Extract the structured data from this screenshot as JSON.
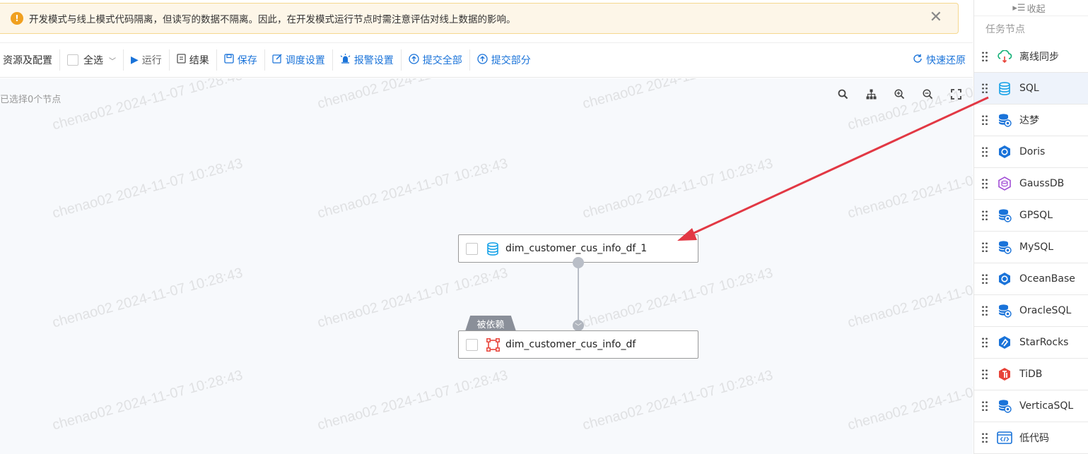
{
  "banner": {
    "message": "开发模式与线上模式代码隔离，但读写的数据不隔离。因此，在开发模式运行节点时需注意评估对线上数据的影响。",
    "close": "✕"
  },
  "toolbar": {
    "resources": "资源及配置",
    "select_all": "全选",
    "run": "运行",
    "results": "结果",
    "save": "保存",
    "schedule": "调度设置",
    "alarm": "报警设置",
    "submit_all": "提交全部",
    "submit_part": "提交部分",
    "quick_restore": "快速还原"
  },
  "canvas": {
    "selected_info": "已选择0个节点",
    "watermark": "chenao02 2024-11-07 10:28:43",
    "nodes": [
      {
        "label": "dim_customer_cus_info_df_1",
        "type": "SQL"
      },
      {
        "label": "dim_customer_cus_info_df",
        "type": "table"
      }
    ],
    "dependency_tag": "被依赖"
  },
  "panel": {
    "collapse": "收起",
    "title": "任务节点",
    "items": [
      {
        "label": "离线同步",
        "icon": "cloud-sync-icon",
        "color": "#19b27a"
      },
      {
        "label": "SQL",
        "icon": "database-icon",
        "color": "#1aa3e8"
      },
      {
        "label": "达梦",
        "icon": "dameng-db-icon",
        "color": "#1a73d9"
      },
      {
        "label": "Doris",
        "icon": "doris-icon",
        "color": "#1a73d9"
      },
      {
        "label": "GaussDB",
        "icon": "gaussdb-icon",
        "color": "#a24fd6"
      },
      {
        "label": "GPSQL",
        "icon": "gpsql-db-icon",
        "color": "#1a73d9"
      },
      {
        "label": "MySQL",
        "icon": "mysql-db-icon",
        "color": "#1a73d9"
      },
      {
        "label": "OceanBase",
        "icon": "oceanbase-icon",
        "color": "#1a73d9"
      },
      {
        "label": "OracleSQL",
        "icon": "oracle-db-icon",
        "color": "#1a73d9"
      },
      {
        "label": "StarRocks",
        "icon": "starrocks-icon",
        "color": "#1a73d9"
      },
      {
        "label": "TiDB",
        "icon": "tidb-icon",
        "color": "#e8443a"
      },
      {
        "label": "VerticaSQL",
        "icon": "vertica-db-icon",
        "color": "#1a73d9"
      },
      {
        "label": "低代码",
        "icon": "low-code-icon",
        "color": "#1a73d9"
      }
    ]
  }
}
